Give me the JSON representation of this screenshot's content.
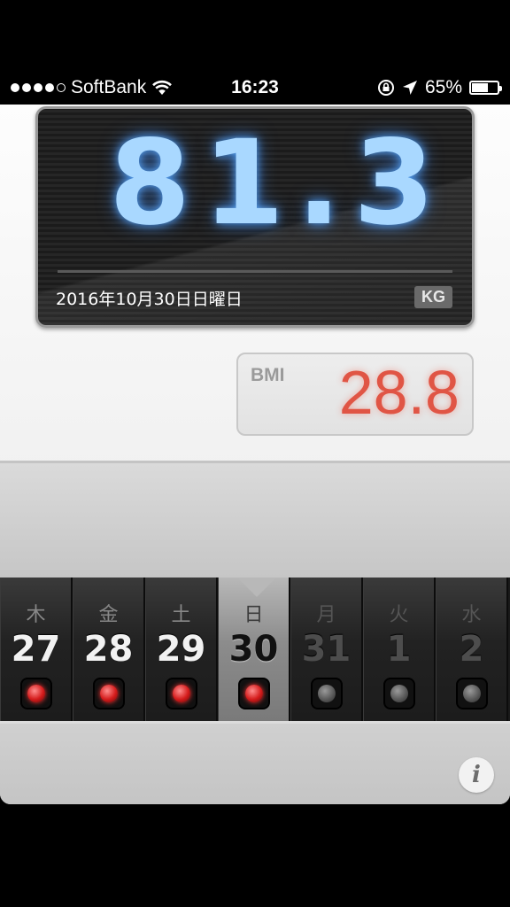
{
  "status_bar": {
    "carrier": "SoftBank",
    "time": "16:23",
    "battery_percent": "65%",
    "battery_level": 0.65,
    "signal_bars_filled": 4,
    "signal_bars_total": 5,
    "icons": [
      "wifi-icon",
      "rotation-lock-icon",
      "location-arrow-icon",
      "battery-icon"
    ]
  },
  "weight_panel": {
    "value": "81.3",
    "date": "2016年10月30日日曜日",
    "unit": "KG",
    "glow_color": "#a9d8ff"
  },
  "bmi": {
    "label": "BMI",
    "value": "28.8",
    "color": "#e05545"
  },
  "days": [
    {
      "dow": "木",
      "num": "27",
      "state": "past",
      "recorded": true
    },
    {
      "dow": "金",
      "num": "28",
      "state": "past",
      "recorded": true
    },
    {
      "dow": "土",
      "num": "29",
      "state": "past",
      "recorded": true
    },
    {
      "dow": "日",
      "num": "30",
      "state": "selected",
      "recorded": true
    },
    {
      "dow": "月",
      "num": "31",
      "state": "future",
      "recorded": false
    },
    {
      "dow": "火",
      "num": "1",
      "state": "future",
      "recorded": false
    },
    {
      "dow": "水",
      "num": "2",
      "state": "future",
      "recorded": false
    }
  ],
  "info_button": {
    "label": "i"
  }
}
